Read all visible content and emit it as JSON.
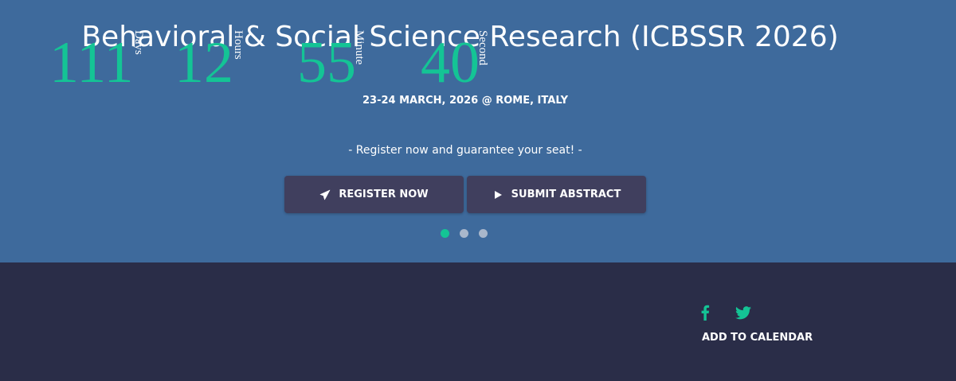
{
  "hero": {
    "title": "Behavioral & Social Science Research (ICBSSR 2026)",
    "date_location": "23-24 MARCH, 2026 @ ROME, ITALY",
    "tagline": "- Register now and guarantee your seat! -",
    "buttons": {
      "register": {
        "label": "REGISTER NOW",
        "icon": "paper-plane-icon"
      },
      "submit": {
        "label": "SUBMIT ABSTRACT",
        "icon": "play-icon"
      }
    },
    "carousel": {
      "slides": 3,
      "active_index": 0
    },
    "colors": {
      "background": "#3e6a9c",
      "button": "#403f5e",
      "accent": "#14c495"
    }
  },
  "countdown": {
    "units": [
      {
        "value": "111",
        "label": "Days"
      },
      {
        "value": "12",
        "label": "Hours"
      },
      {
        "value": "55",
        "label": "Minute"
      },
      {
        "value": "40",
        "label": "Second"
      }
    ],
    "colors": {
      "background": "#2a2d48",
      "number": "#14c495",
      "label": "#ffffff"
    }
  },
  "social": {
    "icons": [
      "facebook-icon",
      "twitter-icon"
    ],
    "add_to_calendar": "ADD TO CALENDAR"
  }
}
